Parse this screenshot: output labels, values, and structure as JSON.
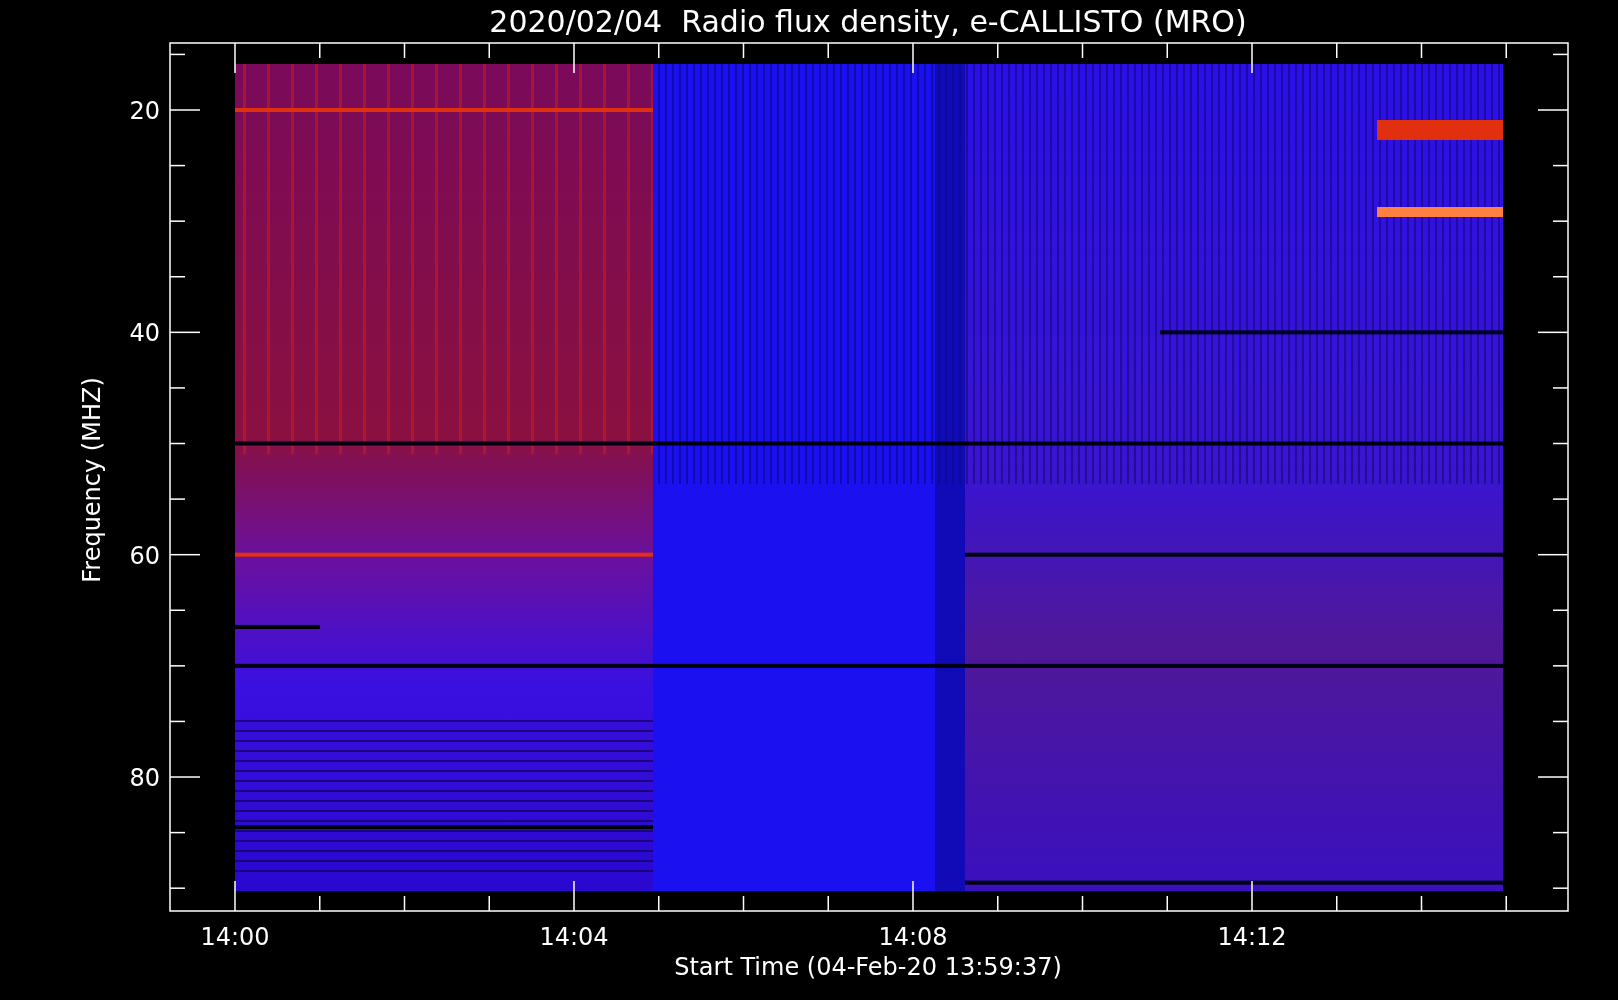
{
  "title": "2020/02/04  Radio flux density, e-CALLISTO (MRO)",
  "y_axis": {
    "label": "Frequency (MHZ)",
    "ticks": [
      "20",
      "40",
      "60",
      "80"
    ]
  },
  "x_axis": {
    "label": "Start Time (04-Feb-20 13:59:37)",
    "ticks": [
      "14:00",
      "14:04",
      "14:08",
      "14:12"
    ]
  }
}
